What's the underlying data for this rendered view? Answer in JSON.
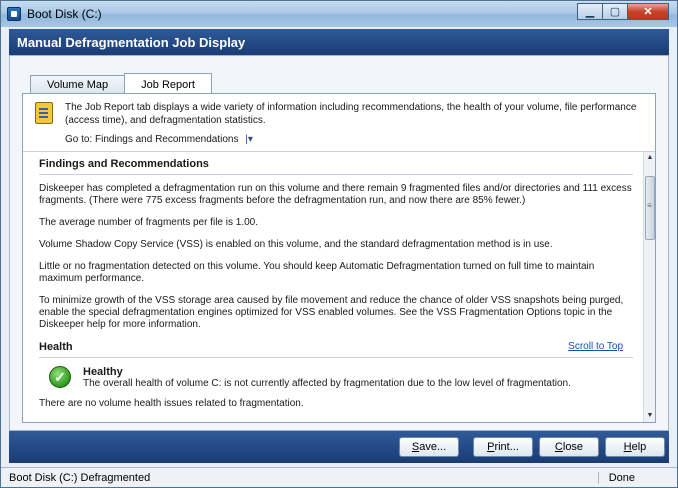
{
  "window": {
    "title": "Boot Disk (C:)",
    "icon": "app-icon"
  },
  "header": {
    "title": "Manual Defragmentation Job Display"
  },
  "tabs": [
    {
      "label": "Volume Map",
      "active": false
    },
    {
      "label": "Job Report",
      "active": true
    }
  ],
  "info": {
    "text": "The Job Report tab displays a wide variety of information including recommendations, the health of your volume, file performance (access time), and defragmentation statistics.",
    "goto_prefix": "Go to:",
    "goto_value": "Findings and Recommendations"
  },
  "report": {
    "findings_heading": "Findings and Recommendations",
    "paragraphs": [
      "Diskeeper has completed a defragmentation run on this volume and there remain 9 fragmented files and/or directories and 111 excess fragments. (There were 775 excess fragments before the defragmentation run, and now there are 85% fewer.)",
      "The average number of fragments per file is 1.00.",
      "Volume Shadow Copy Service (VSS) is enabled on this volume, and the standard defragmentation method is in use.",
      "Little or no fragmentation detected on this volume. You should keep Automatic Defragmentation turned on full time to maintain maximum performance.",
      " To minimize growth of the VSS storage area caused by file movement and reduce the chance of older VSS snapshots being purged, enable the special defragmentation engines optimized for VSS enabled volumes. See the VSS Fragmentation Options topic in the Diskeeper help for more information."
    ],
    "health_heading": "Health",
    "scroll_to_top": "Scroll to Top",
    "health_status": "Healthy",
    "health_detail": "The overall health of volume C: is not currently affected by fragmentation due to the low level of fragmentation.",
    "health_issues": "There are no volume health issues related to fragmentation."
  },
  "buttons": {
    "save": {
      "mnemonic": "S",
      "rest": "ave..."
    },
    "print": {
      "mnemonic": "P",
      "rest": "rint..."
    },
    "close": {
      "mnemonic": "C",
      "rest": "lose"
    },
    "help": {
      "mnemonic": "H",
      "rest": "elp"
    }
  },
  "status": {
    "left": "Boot Disk (C:) Defragmented",
    "right": "Done"
  }
}
